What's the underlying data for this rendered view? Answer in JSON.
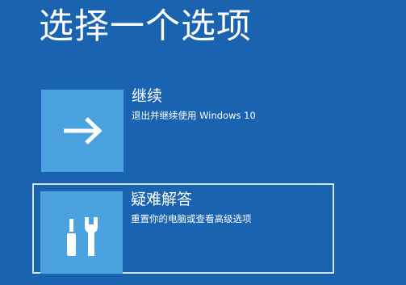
{
  "page": {
    "title": "选择一个选项"
  },
  "options": [
    {
      "label": "继续",
      "description": "退出并继续使用 Windows 10",
      "icon": "arrow-right-icon"
    },
    {
      "label": "疑难解答",
      "description": "重置你的电脑或查看高级选项",
      "icon": "tools-icon"
    }
  ],
  "colors": {
    "background": "#1963b0",
    "tile": "#4aa3de",
    "selection_border": "#d6e4f2",
    "text": "#ffffff"
  }
}
